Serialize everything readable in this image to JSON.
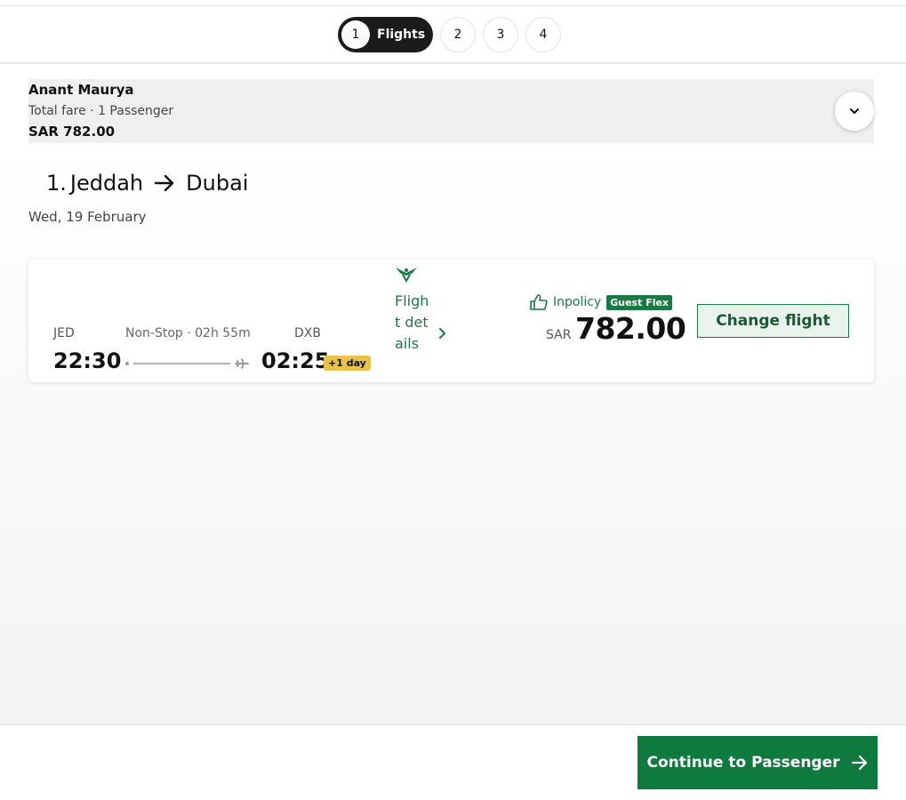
{
  "steps": {
    "active": {
      "number": "1",
      "label": "Flights"
    },
    "others": [
      "2",
      "3",
      "4"
    ]
  },
  "summary": {
    "name": "Anant Maurya",
    "fare_label": "Total fare · 1 Passenger",
    "fare": "SAR 782.00"
  },
  "route": {
    "prefix": "1.",
    "origin": "Jeddah",
    "destination": "Dubai",
    "date": "Wed, 19 February"
  },
  "flight": {
    "dep_code": "JED",
    "dep_time": "22:30",
    "stops": "Non-Stop · 02h 55m",
    "arr_code": "DXB",
    "arr_time": "02:25",
    "day_badge": "+1 day",
    "details_link": "Flight details",
    "policy_label": "Inpolicy",
    "fare_badge": "Guest Flex",
    "currency": "SAR",
    "price": "782.00",
    "change_label": "Change flight"
  },
  "footer": {
    "continue_label": "Continue to Passenger"
  },
  "colors": {
    "brand_green": "#0f7a3e",
    "badge_yellow": "#e9c24a"
  }
}
